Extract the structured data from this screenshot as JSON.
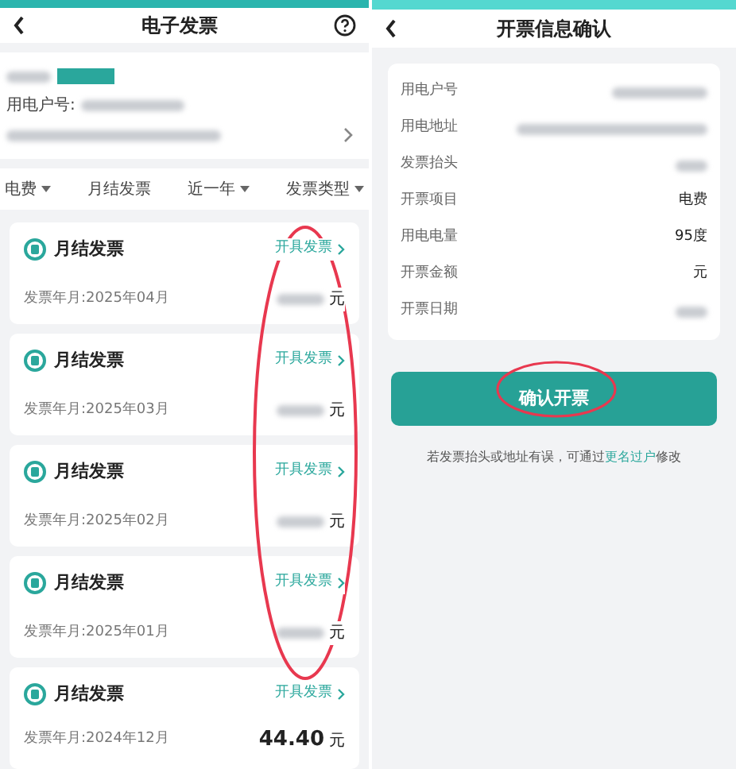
{
  "invoice_list": {
    "title": "电子发票",
    "account": {
      "account_label": "用电户号:"
    },
    "filters": [
      {
        "label": "电费",
        "dropdown": true
      },
      {
        "label": "月结发票",
        "dropdown": false
      },
      {
        "label": "近一年",
        "dropdown": true
      },
      {
        "label": "发票类型",
        "dropdown": true
      }
    ],
    "invoices": [
      {
        "title": "月结发票",
        "action": "开具发票",
        "period": "发票年月:2025年04月",
        "currency": "元"
      },
      {
        "title": "月结发票",
        "action": "开具发票",
        "period": "发票年月:2025年03月",
        "currency": "元"
      },
      {
        "title": "月结发票",
        "action": "开具发票",
        "period": "发票年月:2025年02月",
        "currency": "元"
      },
      {
        "title": "月结发票",
        "action": "开具发票",
        "period": "发票年月:2025年01月",
        "currency": "元"
      },
      {
        "title": "月结发票",
        "action": "开具发票",
        "period": "发票年月:2024年12月",
        "amount": "44.40",
        "currency": "元"
      }
    ]
  },
  "confirm": {
    "title": "开票信息确认",
    "rows": [
      {
        "label": "用电户号"
      },
      {
        "label": "用电地址"
      },
      {
        "label": "发票抬头"
      },
      {
        "label": "开票项目",
        "value": "电费"
      },
      {
        "label": "用电电量",
        "value": "95度"
      },
      {
        "label": "开票金额",
        "value": "元"
      },
      {
        "label": "开票日期"
      }
    ],
    "button": "确认开票",
    "note": "若发票抬头或地址有误，可通过",
    "note_link": "更名过户",
    "note_end": "修改"
  }
}
